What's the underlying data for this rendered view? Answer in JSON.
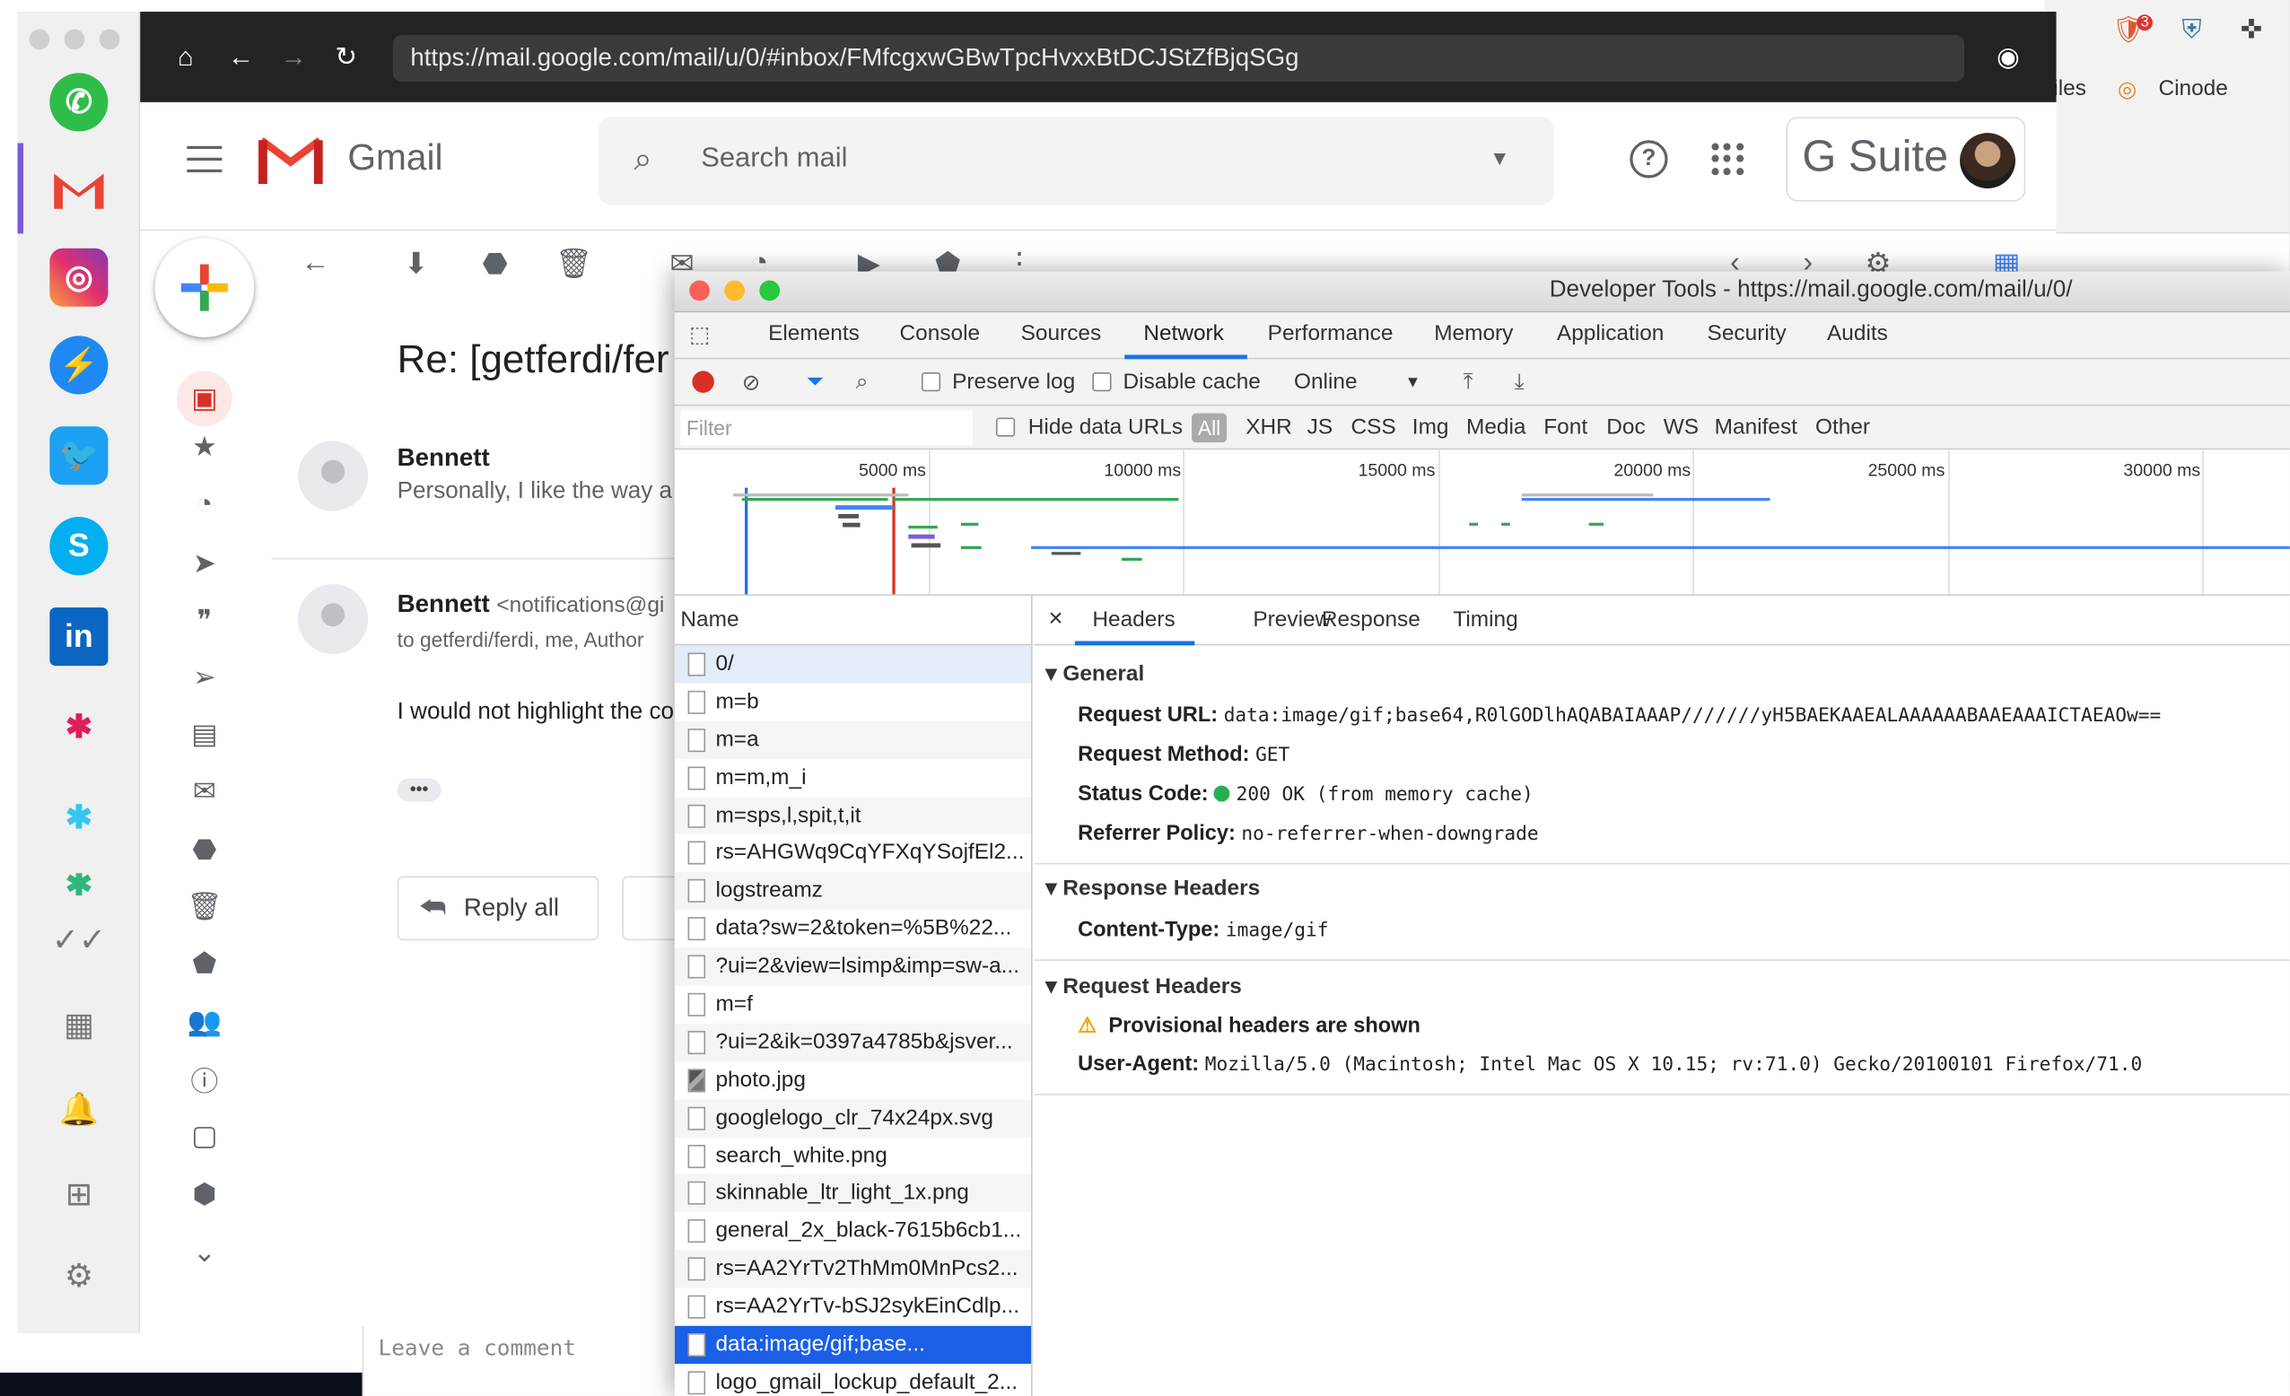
{
  "browser": {
    "url": "https://mail.google.com/mail/u/0/#inbox/FMfcgxwGBwTpcHvxxBtDCJStZfBjqSGg"
  },
  "background_window": {
    "bookmarks": [
      "iles",
      "Cinode"
    ],
    "extension_badge": "3"
  },
  "gmail": {
    "brand": "Gmail",
    "search_placeholder": "Search mail",
    "gsuite_label": "G Suite",
    "subject": "Re: [getferdi/fer",
    "messages": [
      {
        "sender": "Bennett",
        "snippet": "Personally, I like the way a"
      },
      {
        "sender": "Bennett",
        "email": "<notifications@gi",
        "to": "to getferdi/ferdi, me, Author",
        "body": "I would not highlight the co"
      }
    ],
    "reply_all": "Reply all",
    "ellipsis": "•••",
    "comment_placeholder": "Leave a comment"
  },
  "devtools": {
    "title": "Developer Tools - https://mail.google.com/mail/u/0/",
    "tabs": [
      "Elements",
      "Console",
      "Sources",
      "Network",
      "Performance",
      "Memory",
      "Application",
      "Security",
      "Audits"
    ],
    "active_tab": "Network",
    "toolbar": {
      "preserve_log": "Preserve log",
      "disable_cache": "Disable cache",
      "throttle": "Online"
    },
    "filter": {
      "placeholder": "Filter",
      "hide_data_urls": "Hide data URLs",
      "types": [
        "All",
        "XHR",
        "JS",
        "CSS",
        "Img",
        "Media",
        "Font",
        "Doc",
        "WS",
        "Manifest",
        "Other"
      ]
    },
    "timeline_ticks": [
      "5000 ms",
      "10000 ms",
      "15000 ms",
      "20000 ms",
      "25000 ms",
      "30000 ms"
    ],
    "requests_header": "Name",
    "requests": [
      "0/",
      "m=b",
      "m=a",
      "m=m,m_i",
      "m=sps,l,spit,t,it",
      "rs=AHGWq9CqYFXqYSojfEl2...",
      "logstreamz",
      "data?sw=2&token=%5B%22...",
      "?ui=2&view=lsimp&imp=sw-a...",
      "m=f",
      "?ui=2&ik=0397a4785b&jsver...",
      "photo.jpg",
      "googlelogo_clr_74x24px.svg",
      "search_white.png",
      "skinnable_ltr_light_1x.png",
      "general_2x_black-7615b6cb1...",
      "rs=AA2YrTv2ThMm0MnPcs2...",
      "rs=AA2YrTv-bSJ2sykEinCdlp...",
      "data:image/gif;base...",
      "logo_gmail_lockup_default_2..."
    ],
    "selected_request": "data:image/gif;base...",
    "detail_tabs": [
      "Headers",
      "Preview",
      "Response",
      "Timing"
    ],
    "active_detail_tab": "Headers",
    "close": "×",
    "general": {
      "title": "General",
      "request_url_label": "Request URL:",
      "request_url": "data:image/gif;base64,R0lGODlhAQABAIAAAP///////yH5BAEKAAEALAAAAAABAAEAAAICTAEAOw==",
      "request_method_label": "Request Method:",
      "request_method": "GET",
      "status_code_label": "Status Code:",
      "status_code": "200 OK (from memory cache)",
      "referrer_policy_label": "Referrer Policy:",
      "referrer_policy": "no-referrer-when-downgrade"
    },
    "response_headers": {
      "title": "Response Headers",
      "content_type_label": "Content-Type:",
      "content_type": "image/gif"
    },
    "request_headers": {
      "title": "Request Headers",
      "warning": "Provisional headers are shown",
      "user_agent_label": "User-Agent:",
      "user_agent": "Mozilla/5.0 (Macintosh; Intel Mac OS X 10.15; rv:71.0) Gecko/20100101 Firefox/71.0"
    }
  },
  "colors": {
    "accent_blue": "#1a73e8",
    "selected_row": "#1a5fe6",
    "status_green": "#22b14c",
    "record_red": "#d93025"
  }
}
